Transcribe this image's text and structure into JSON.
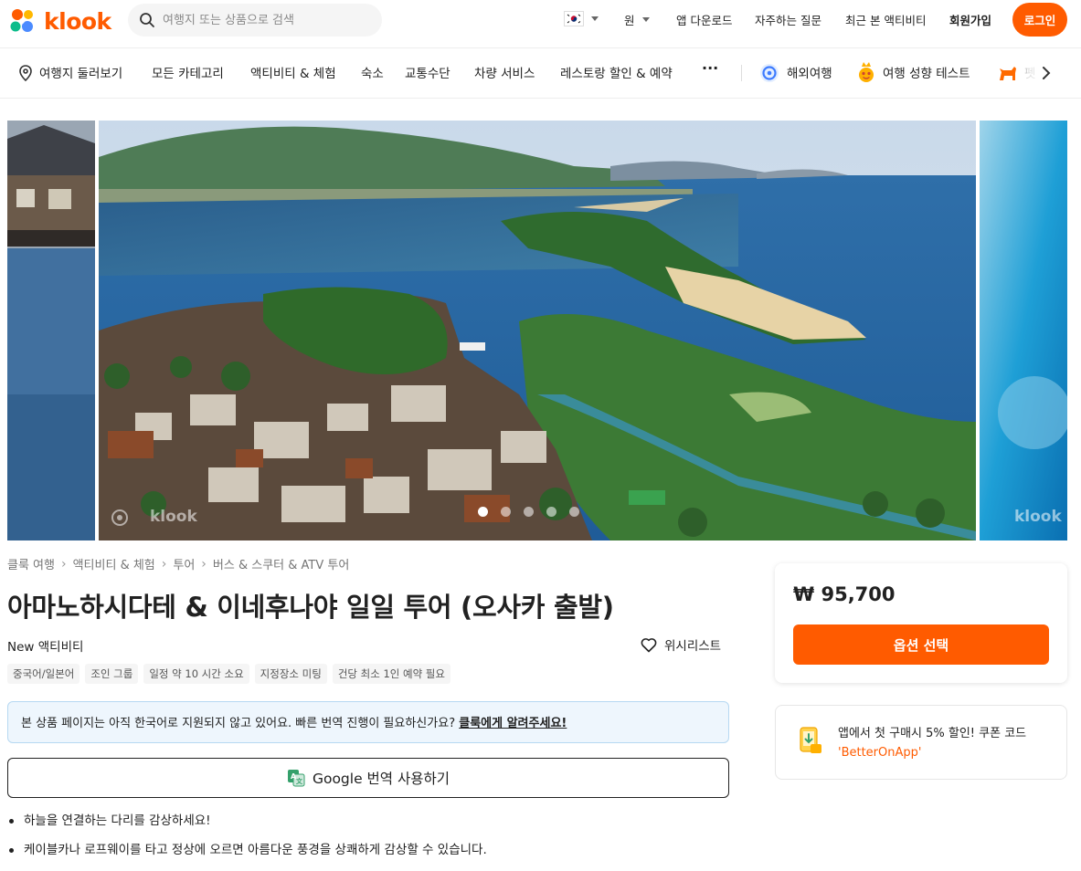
{
  "header": {
    "logo_text": "klook",
    "search_placeholder": "여행지 또는 상품으로 검색",
    "currency": "원",
    "links": [
      "앱 다운로드",
      "자주하는 질문",
      "최근 본 액티비티"
    ],
    "signup": "회원가입",
    "login": "로그인"
  },
  "categories": {
    "items": [
      "여행지 둘러보기",
      "모든 카테고리",
      "액티비티 & 체험",
      "숙소",
      "교통수단",
      "차량 서비스",
      "레스토랑 할인 & 예약"
    ],
    "more": "···",
    "overseas": "해외여행",
    "travel_test": "여행 성향 테스트",
    "partial": "펫"
  },
  "hero": {
    "watermark": "klook",
    "slide_count": 5,
    "active_slide": 1
  },
  "breadcrumb": [
    "클룩 여행",
    "액티비티 & 체험",
    "투어",
    "버스 & 스쿠터 & ATV 투어"
  ],
  "product": {
    "title": "아마노하시다테 & 이네후나야 일일 투어 (오사카 출발)",
    "new_label": "New 액티비티",
    "wishlist": "위시리스트",
    "tags": [
      "중국어/일본어",
      "조인 그룹",
      "일정 약 10 시간 소요",
      "지정장소 미팅",
      "건당 최소 1인 예약 필요"
    ],
    "notice_text": "본 상품 페이지는 아직 한국어로 지원되지 않고 있어요. 빠른 번역 진행이 필요하신가요?",
    "notice_link": "클룩에게 알려주세요!",
    "google_btn": "Google 번역 사용하기",
    "bullets": [
      "하늘을 연결하는 다리를 감상하세요!",
      "케이블카나 로프웨이를 타고 정상에 오르면 아름다운 풍경을 상쾌하게 감상할 수 있습니다."
    ]
  },
  "price_card": {
    "price": "₩ 95,700",
    "button": "옵션 선택"
  },
  "coupon": {
    "text": "앱에서 첫 구매시 5% 할인! 쿠폰 코드",
    "code": "'BetterOnApp'"
  },
  "colors": {
    "brand": "#ff5b00",
    "notice_bg": "#eef6fd"
  }
}
